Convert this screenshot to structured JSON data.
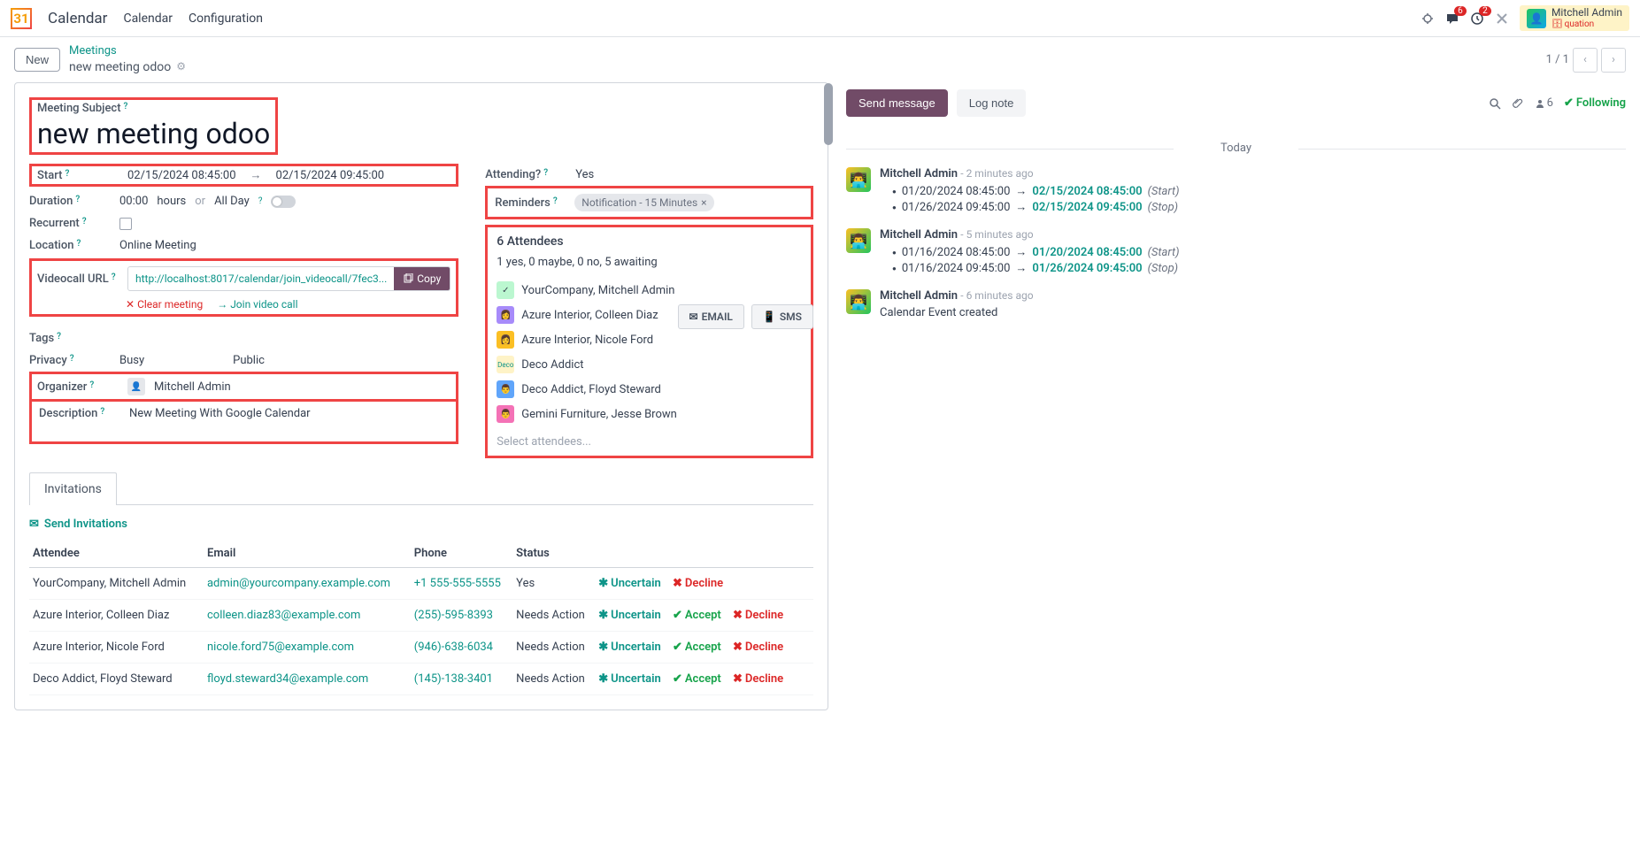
{
  "topbar": {
    "app_title": "Calendar",
    "nav": [
      "Calendar",
      "Configuration"
    ],
    "chat_badge": "6",
    "clock_badge": "2",
    "user_name": "Mitchell Admin",
    "user_db": "quation"
  },
  "breadcrumb": {
    "new_label": "New",
    "parent": "Meetings",
    "current": "new meeting odoo",
    "pager": "1 / 1"
  },
  "form": {
    "subject_label": "Meeting Subject",
    "subject_value": "new meeting odoo",
    "start_label": "Start",
    "start_value": "02/15/2024 08:45:00",
    "end_value": "02/15/2024 09:45:00",
    "duration_label": "Duration",
    "duration_value": "00:00",
    "duration_hours": "hours",
    "duration_or": "or",
    "duration_allday": "All Day",
    "recurrent_label": "Recurrent",
    "location_label": "Location",
    "location_value": "Online Meeting",
    "videocall_label": "Videocall URL",
    "videocall_value": "http://localhost:8017/calendar/join_videocall/7fec3...",
    "copy_label": "Copy",
    "clear_meeting": "Clear meeting",
    "join_video": "Join video call",
    "tags_label": "Tags",
    "privacy_label": "Privacy",
    "privacy_busy": "Busy",
    "privacy_public": "Public",
    "organizer_label": "Organizer",
    "organizer_value": "Mitchell Admin",
    "description_label": "Description",
    "description_value": "New Meeting With Google Calendar",
    "attending_label": "Attending?",
    "attending_value": "Yes",
    "reminders_label": "Reminders",
    "reminder_tag": "Notification - 15 Minutes",
    "attendees_count": "6 Attendees",
    "attendees_status": "1 yes, 0 maybe, 0 no, 5 awaiting",
    "attendees": [
      "YourCompany, Mitchell Admin",
      "Azure Interior, Colleen Diaz",
      "Azure Interior, Nicole Ford",
      "Deco Addict",
      "Deco Addict, Floyd Steward",
      "Gemini Furniture, Jesse Brown"
    ],
    "attendees_placeholder": "Select attendees...",
    "email_btn": "EMAIL",
    "sms_btn": "SMS"
  },
  "invitations": {
    "tab_label": "Invitations",
    "send_label": "Send Invitations",
    "headers": {
      "attendee": "Attendee",
      "email": "Email",
      "phone": "Phone",
      "status": "Status"
    },
    "rows": [
      {
        "name": "YourCompany, Mitchell Admin",
        "email": "admin@yourcompany.example.com",
        "phone": "+1 555-555-5555",
        "status": "Yes",
        "actions": [
          "Uncertain",
          "Decline"
        ]
      },
      {
        "name": "Azure Interior, Colleen Diaz",
        "email": "colleen.diaz83@example.com",
        "phone": "(255)-595-8393",
        "status": "Needs Action",
        "actions": [
          "Uncertain",
          "Accept",
          "Decline"
        ]
      },
      {
        "name": "Azure Interior, Nicole Ford",
        "email": "nicole.ford75@example.com",
        "phone": "(946)-638-6034",
        "status": "Needs Action",
        "actions": [
          "Uncertain",
          "Accept",
          "Decline"
        ]
      },
      {
        "name": "Deco Addict, Floyd Steward",
        "email": "floyd.steward34@example.com",
        "phone": "(145)-138-3401",
        "status": "Needs Action",
        "actions": [
          "Uncertain",
          "Accept",
          "Decline"
        ]
      }
    ],
    "uncertain": "Uncertain",
    "accept": "Accept",
    "decline": "Decline"
  },
  "chatter": {
    "send_msg": "Send message",
    "log_note": "Log note",
    "follower_count": "6",
    "following": "Following",
    "today": "Today",
    "entries": [
      {
        "author": "Mitchell Admin",
        "time": "- 2 minutes ago",
        "bullets": [
          {
            "old": "01/20/2024 08:45:00",
            "new": "02/15/2024 08:45:00",
            "tag": "(Start)"
          },
          {
            "old": "01/26/2024 09:45:00",
            "new": "02/15/2024 09:45:00",
            "tag": "(Stop)"
          }
        ]
      },
      {
        "author": "Mitchell Admin",
        "time": "- 5 minutes ago",
        "bullets": [
          {
            "old": "01/16/2024 08:45:00",
            "new": "01/20/2024 08:45:00",
            "tag": "(Start)"
          },
          {
            "old": "01/16/2024 09:45:00",
            "new": "01/26/2024 09:45:00",
            "tag": "(Stop)"
          }
        ]
      },
      {
        "author": "Mitchell Admin",
        "time": "- 6 minutes ago",
        "text": "Calendar Event created"
      }
    ]
  }
}
